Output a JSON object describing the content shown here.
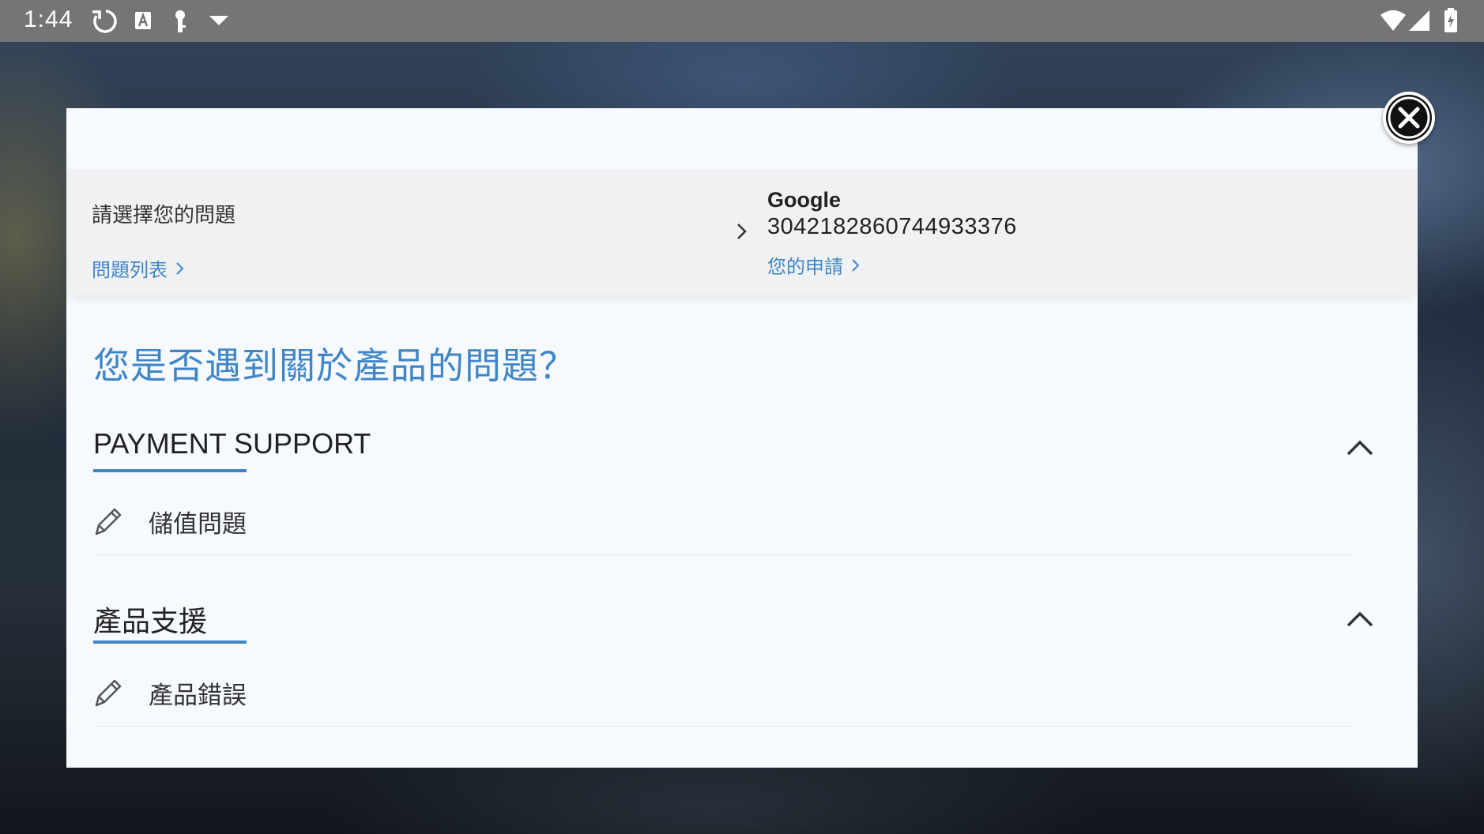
{
  "status_bar": {
    "time": "1:44",
    "icons": [
      "sync-icon",
      "a-notification-icon",
      "key-icon",
      "dropdown-triangle-icon",
      "wifi-icon",
      "signal-icon",
      "battery-charging-icon"
    ]
  },
  "breadcrumb": {
    "left_title": "請選擇您的問題",
    "left_link": "問題列表",
    "provider": "Google",
    "account_id": "3042182860744933376",
    "right_link": "您的申請"
  },
  "main": {
    "heading": "您是否遇到關於產品的問題？",
    "sections": [
      {
        "title": "PAYMENT SUPPORT",
        "items": [
          {
            "label": "儲值問題",
            "icon": "pencil-icon"
          }
        ]
      },
      {
        "title": "產品支援",
        "items": [
          {
            "label": "產品錯誤",
            "icon": "pencil-icon"
          }
        ]
      }
    ]
  },
  "colors": {
    "accent": "#3f86c8",
    "status_bar": "#757575",
    "modal_bg": "#f6f9fd",
    "breadcrumb_bg": "#f0f1f2"
  }
}
